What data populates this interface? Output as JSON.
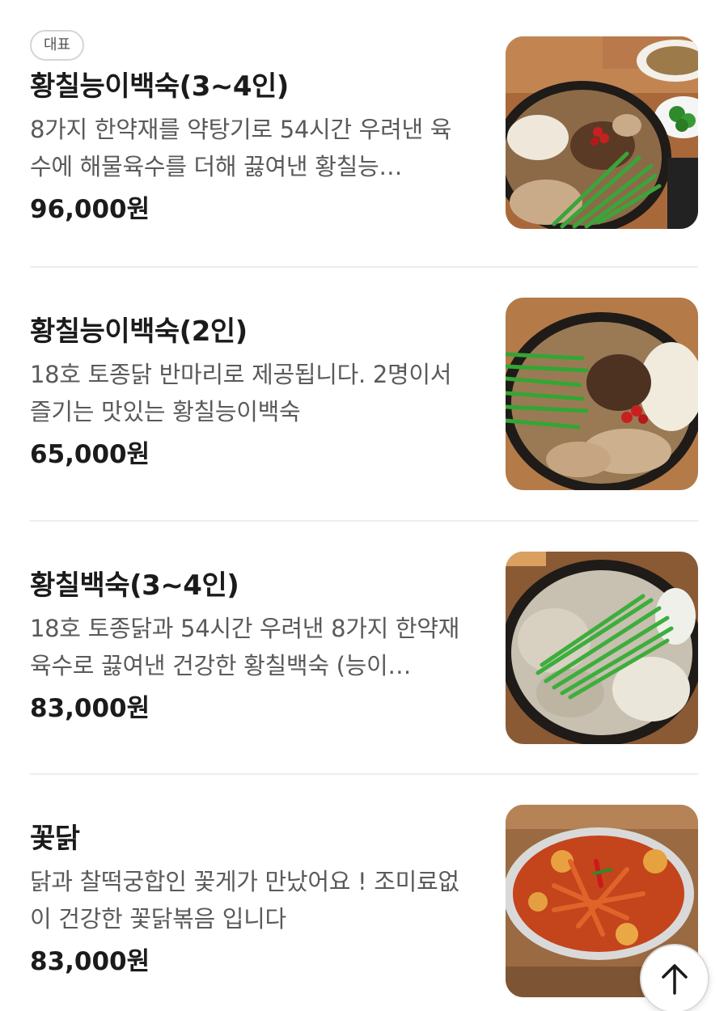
{
  "menu": {
    "items": [
      {
        "badge": "대표",
        "name": "황칠능이백숙(3~4인)",
        "description": "8가지 한약재를 약탕기로 54시간 우려낸 육수에 해물육수를 더해 끓여낸 황칠능…",
        "price": "96,000원",
        "image": "hwangchil-neungi-baeksuk-large-photo"
      },
      {
        "name": "황칠능이백숙(2인)",
        "description": "18호 토종닭 반마리로 제공됩니다. 2명이서 즐기는 맛있는 황칠능이백숙",
        "price": "65,000원",
        "image": "hwangchil-neungi-baeksuk-half-photo"
      },
      {
        "name": "황칠백숙(3~4인)",
        "description": "18호 토종닭과 54시간 우려낸 8가지 한약재육수로 끓여낸 건강한 황칠백숙 (능이…",
        "price": "83,000원",
        "image": "hwangchil-baeksuk-photo"
      },
      {
        "name": "꽃닭",
        "description": "닭과 찰떡궁합인 꽃게가 만났어요 ! 조미료없이 건강한 꽃닭볶음 입니다",
        "price": "83,000원",
        "image": "kkotdak-crab-chicken-photo"
      }
    ]
  },
  "scroll_top_icon": "arrow-up-icon"
}
